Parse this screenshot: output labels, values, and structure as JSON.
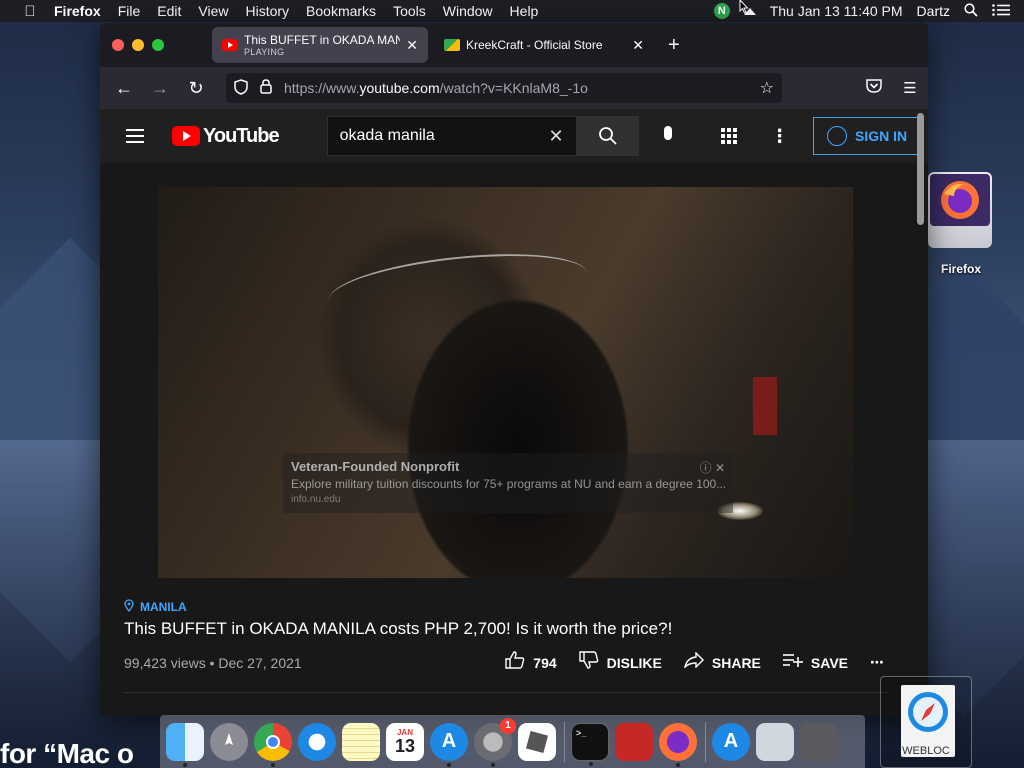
{
  "menubar": {
    "app": "Firefox",
    "items": [
      "File",
      "Edit",
      "View",
      "History",
      "Bookmarks",
      "Tools",
      "Window",
      "Help"
    ],
    "clock": "Thu Jan 13  11:40 PM",
    "user": "Dartz",
    "status_icons": [
      "norton-icon",
      "eject-icon",
      "search-icon",
      "list-icon"
    ],
    "n_badge": "N"
  },
  "desktop": {
    "icon_label": "Firefox",
    "partial_text": "for “Mac o"
  },
  "browser": {
    "tabs": [
      {
        "title": "This BUFFET in OKADA MANILA",
        "subtitle": "PLAYING",
        "favicon": "youtube-icon",
        "active": true
      },
      {
        "title": "KreekCraft - Official Store",
        "favicon": "kreekcraft-icon",
        "active": false
      }
    ],
    "url_prefix": "https://www.",
    "url_domain": "youtube.com",
    "url_path": "/watch?v=KKnlaM8_-1o"
  },
  "youtube": {
    "logo": "YouTube",
    "search_value": "okada manila",
    "sign_in": "SIGN IN",
    "ad": {
      "title": "Veteran-Founded Nonprofit",
      "body": "Explore military tuition discounts for 75+ programs at NU and earn a degree 100...",
      "domain": "info.nu.edu"
    },
    "video": {
      "location": "MANILA",
      "title": "This BUFFET in OKADA MANILA costs PHP 2,700! Is it worth the price?!",
      "stats": "99,423 views • Dec 27, 2021",
      "likes": "794",
      "dislike": "DISLIKE",
      "share": "SHARE",
      "save": "SAVE"
    }
  },
  "dock": {
    "calendar_month": "JAN",
    "calendar_day": "13",
    "sysprefs_badge": "1",
    "webloc_label": "WEBLOC"
  },
  "colors": {
    "accent": "#3ea6ff",
    "youtube_red": "#ff0000",
    "yt_bg": "#181818"
  }
}
